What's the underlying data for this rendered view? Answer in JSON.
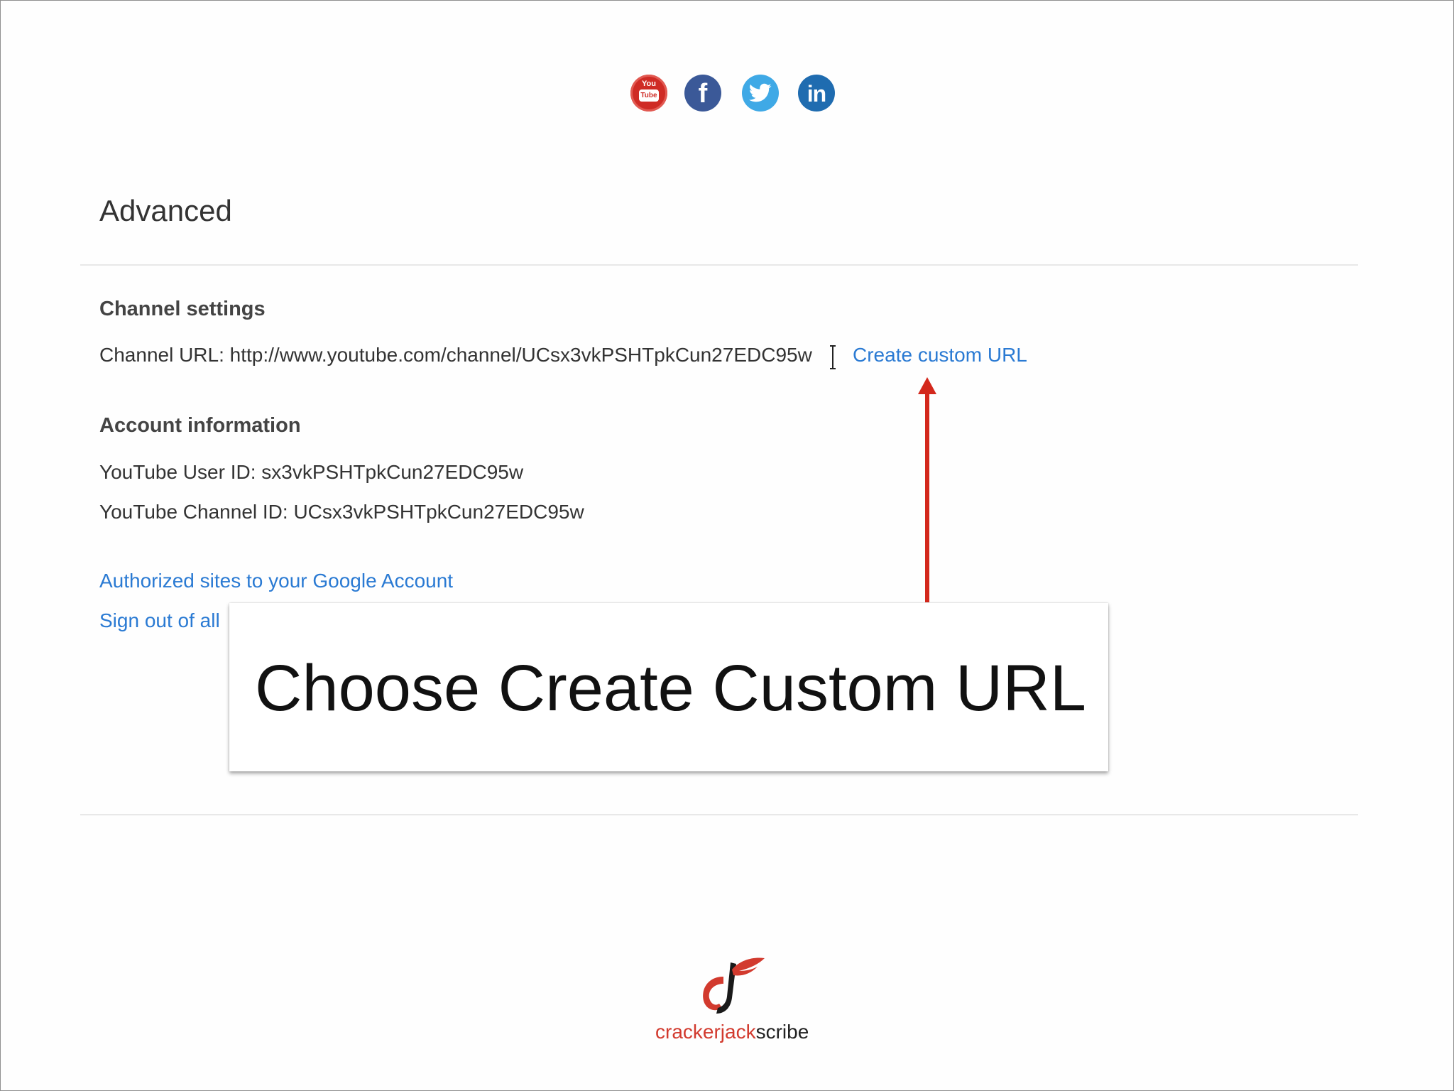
{
  "social_icons": [
    {
      "name": "youtube-icon",
      "line1": "You",
      "line2": "Tube",
      "color": "#cf2b25"
    },
    {
      "name": "facebook-icon",
      "glyph": "f",
      "color": "#3b5998"
    },
    {
      "name": "twitter-icon",
      "color": "#3fa9e6"
    },
    {
      "name": "linkedin-icon",
      "glyph": "in",
      "color": "#1f6cb0"
    }
  ],
  "advanced": {
    "title": "Advanced"
  },
  "channel_settings": {
    "title": "Channel settings",
    "url_label": "Channel URL:",
    "url_value": "http://www.youtube.com/channel/UCsx3vkPSHTpkCun27EDC95w",
    "create_custom_url": "Create custom URL"
  },
  "account_information": {
    "title": "Account information",
    "user_id_label": "YouTube User ID:",
    "user_id": "sx3vkPSHTpkCun27EDC95w",
    "channel_id_label": "YouTube Channel ID:",
    "channel_id": "UCsx3vkPSHTpkCun27EDC95w"
  },
  "links": {
    "authorized_sites": "Authorized sites to your Google Account",
    "sign_out_partial": "Sign out of all"
  },
  "callout": {
    "text": "Choose Create Custom URL"
  },
  "logo": {
    "text_part1": "crackerjack",
    "text_part2": "scribe",
    "accent_color": "#d23a2e"
  },
  "colors": {
    "link": "#2a7ad3",
    "arrow": "#d3281c"
  }
}
